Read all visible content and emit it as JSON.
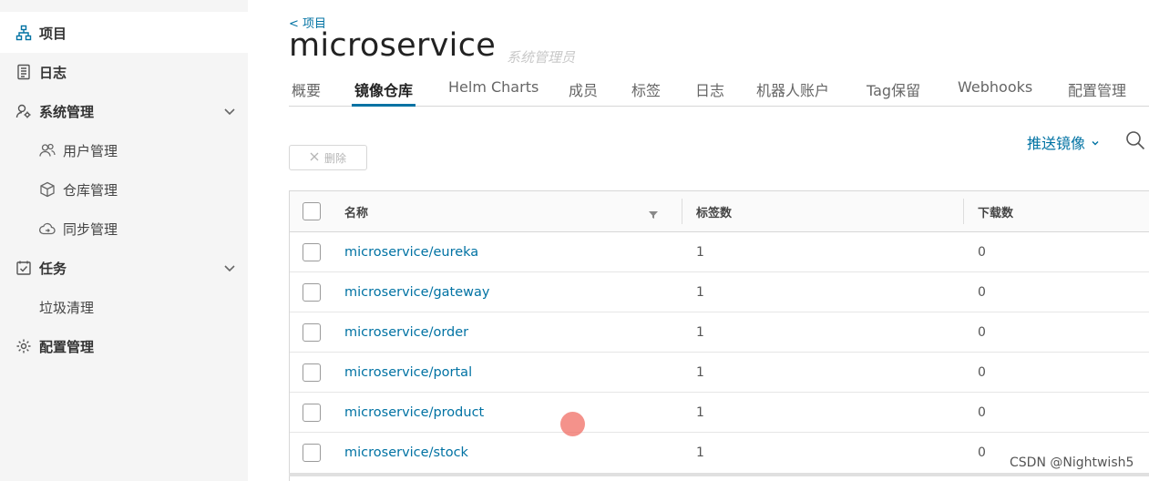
{
  "sidebar": {
    "items": [
      {
        "label": "项目",
        "icon": "project-icon"
      },
      {
        "label": "日志",
        "icon": "log-icon"
      },
      {
        "label": "系统管理",
        "icon": "system-admin-icon"
      },
      {
        "label": "用户管理",
        "icon": "users-icon"
      },
      {
        "label": "仓库管理",
        "icon": "registry-icon"
      },
      {
        "label": "同步管理",
        "icon": "replication-icon"
      },
      {
        "label": "任务",
        "icon": "tasks-icon"
      },
      {
        "label": "垃圾清理"
      },
      {
        "label": "配置管理",
        "icon": "gear-icon"
      }
    ]
  },
  "header": {
    "back_label": "< 项目",
    "project_name": "microservice",
    "role": "系统管理员"
  },
  "tabs": [
    {
      "label": "概要"
    },
    {
      "label": "镜像仓库",
      "active": true
    },
    {
      "label": "Helm Charts"
    },
    {
      "label": "成员"
    },
    {
      "label": "标签"
    },
    {
      "label": "日志"
    },
    {
      "label": "机器人账户"
    },
    {
      "label": "Tag保留"
    },
    {
      "label": "Webhooks"
    },
    {
      "label": "配置管理"
    }
  ],
  "toolbar": {
    "delete_label": "删除",
    "push_label": "推送镜像"
  },
  "table": {
    "columns": [
      "名称",
      "标签数",
      "下载数"
    ],
    "rows": [
      {
        "name": "microservice/eureka",
        "tags": "1",
        "downloads": "0"
      },
      {
        "name": "microservice/gateway",
        "tags": "1",
        "downloads": "0"
      },
      {
        "name": "microservice/order",
        "tags": "1",
        "downloads": "0"
      },
      {
        "name": "microservice/portal",
        "tags": "1",
        "downloads": "0"
      },
      {
        "name": "microservice/product",
        "tags": "1",
        "downloads": "0"
      },
      {
        "name": "microservice/stock",
        "tags": "1",
        "downloads": "0"
      }
    ]
  },
  "watermark": "CSDN @Nightwish5",
  "colors": {
    "accent": "#0072a3",
    "sidebar_bg": "#f5f5f5"
  }
}
